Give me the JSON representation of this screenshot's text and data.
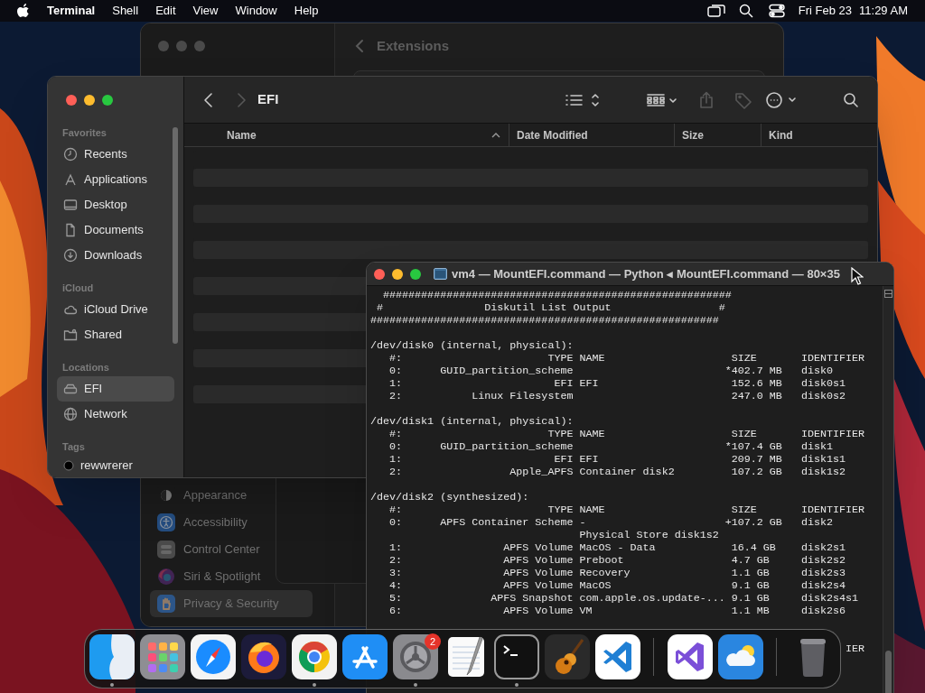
{
  "menu_bar": {
    "app_name": "Terminal",
    "menus": [
      "Shell",
      "Edit",
      "View",
      "Window",
      "Help"
    ],
    "date": "Fri Feb 23",
    "time": "11:29 AM"
  },
  "settings_window": {
    "title": "Extensions",
    "sidebar": [
      {
        "label": "Appearance",
        "kind": "appearance",
        "selected": false
      },
      {
        "label": "Accessibility",
        "kind": "accessibility",
        "selected": false
      },
      {
        "label": "Control Center",
        "kind": "control",
        "selected": false
      },
      {
        "label": "Siri & Spotlight",
        "kind": "siri",
        "selected": false
      },
      {
        "label": "Privacy & Security",
        "kind": "privacy",
        "selected": true
      }
    ]
  },
  "finder": {
    "title": "EFI",
    "toolbar": [
      {
        "kind": "back",
        "disabled": false
      },
      {
        "kind": "forward",
        "disabled": true
      },
      {
        "kind": "list",
        "disabled": false
      },
      {
        "kind": "grid",
        "disabled": false
      },
      {
        "kind": "share",
        "disabled": true
      },
      {
        "kind": "tag",
        "disabled": true
      },
      {
        "kind": "more",
        "disabled": false
      },
      {
        "kind": "search",
        "disabled": false
      }
    ],
    "sidebar": [
      {
        "heading": "Favorites",
        "items": [
          {
            "label": "Recents",
            "kind": "clock",
            "selected": false
          },
          {
            "label": "Applications",
            "kind": "apps",
            "selected": false
          },
          {
            "label": "Desktop",
            "kind": "desktop",
            "selected": false
          },
          {
            "label": "Documents",
            "kind": "document",
            "selected": false
          },
          {
            "label": "Downloads",
            "kind": "download",
            "selected": false
          }
        ]
      },
      {
        "heading": "iCloud",
        "items": [
          {
            "label": "iCloud Drive",
            "kind": "cloud",
            "selected": false
          },
          {
            "label": "Shared",
            "kind": "folder",
            "selected": false
          }
        ]
      },
      {
        "heading": "Locations",
        "items": [
          {
            "label": "EFI",
            "kind": "drive",
            "selected": true
          },
          {
            "label": "Network",
            "kind": "globe",
            "selected": false
          }
        ]
      },
      {
        "heading": "Tags",
        "items": [
          {
            "label": "rewwrerer",
            "kind": "tag",
            "selected": false
          }
        ]
      }
    ],
    "columns": [
      {
        "label": "Name",
        "sorted": true
      },
      {
        "label": "Date Modified",
        "sorted": false
      },
      {
        "label": "Size",
        "sorted": false
      },
      {
        "label": "Kind",
        "sorted": false
      }
    ]
  },
  "terminal": {
    "title": "vm4 — MountEFI.command — Python ◂ MountEFI.command — 80×35",
    "blocks": [
      {
        "kind": "output",
        "lines": [
          "  #######################################################",
          " #                Diskutil List Output                 #",
          "#######################################################"
        ]
      },
      {
        "kind": "output",
        "lines": [
          "/dev/disk0 (internal, physical):",
          "   #:                       TYPE NAME                    SIZE       IDENTIFIER",
          "   0:      GUID_partition_scheme                        *402.7 MB   disk0",
          "   1:                        EFI EFI                     152.6 MB   disk0s1",
          "   2:           Linux Filesystem                         247.0 MB   disk0s2"
        ]
      },
      {
        "kind": "output",
        "lines": [
          "/dev/disk1 (internal, physical):",
          "   #:                       TYPE NAME                    SIZE       IDENTIFIER",
          "   0:      GUID_partition_scheme                        *107.4 GB   disk1",
          "   1:                        EFI EFI                     209.7 MB   disk1s1",
          "   2:                 Apple_APFS Container disk2         107.2 GB   disk1s2"
        ]
      },
      {
        "kind": "output",
        "lines": [
          "/dev/disk2 (synthesized):",
          "   #:                       TYPE NAME                    SIZE       IDENTIFIER",
          "   0:      APFS Container Scheme -                      +107.2 GB   disk2",
          "                                 Physical Store disk1s2",
          "   1:                APFS Volume MacOS - Data            16.4 GB    disk2s1",
          "   2:                APFS Volume Preboot                 4.7 GB     disk2s2",
          "   3:                APFS Volume Recovery                1.1 GB     disk2s3",
          "   4:                APFS Volume MacOS                   9.1 GB     disk2s4",
          "   5:              APFS Snapshot com.apple.os.update-... 9.1 GB     disk2s4s1",
          "   6:                APFS Volume VM                      1.1 MB     disk2s6"
        ]
      },
      {
        "kind": "tail",
        "lines": [
          "IER"
        ]
      }
    ]
  },
  "dock": {
    "groups": [
      [
        {
          "kind": "finder",
          "running": true
        },
        {
          "kind": "launchpad",
          "running": false
        },
        {
          "kind": "safari",
          "running": false
        },
        {
          "kind": "firefox",
          "running": false
        },
        {
          "kind": "chrome",
          "running": true
        },
        {
          "kind": "appstore",
          "running": false
        },
        {
          "kind": "settings",
          "running": true,
          "badge": "2"
        },
        {
          "kind": "textedit",
          "running": false
        },
        {
          "kind": "terminal",
          "running": true
        },
        {
          "kind": "garageband",
          "running": false
        },
        {
          "kind": "vscode",
          "running": false
        }
      ],
      [
        {
          "kind": "visualstudio",
          "running": false
        },
        {
          "kind": "weather",
          "running": false
        }
      ],
      [
        {
          "kind": "trash",
          "running": false
        }
      ]
    ]
  }
}
